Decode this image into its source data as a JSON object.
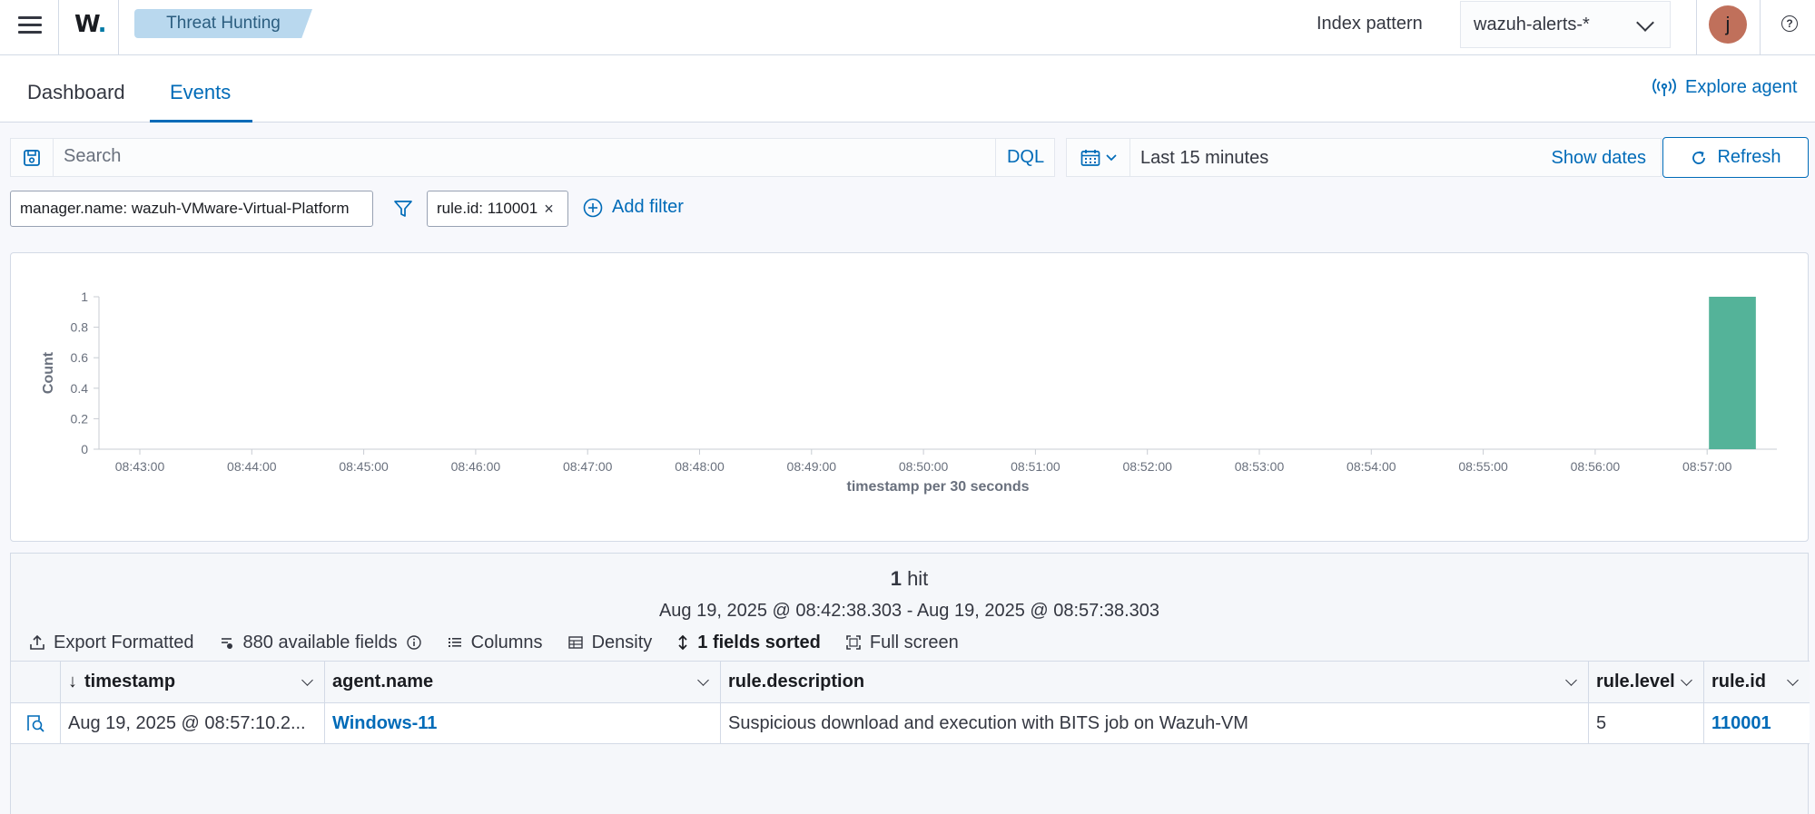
{
  "header": {
    "logo_text": "W",
    "breadcrumb": "Threat Hunting",
    "index_pattern_label": "Index pattern",
    "index_pattern_value": "wazuh-alerts-*",
    "avatar_initial": "j",
    "help_symbol": "?"
  },
  "tabs": [
    {
      "label": "Dashboard",
      "active": false
    },
    {
      "label": "Events",
      "active": true
    }
  ],
  "explore_agent_label": "Explore agent",
  "search": {
    "placeholder": "Search",
    "language": "DQL",
    "date_range": "Last 15 minutes",
    "show_dates_label": "Show dates",
    "refresh_label": "Refresh"
  },
  "filters": {
    "pills": [
      "manager.name: wazuh-VMware-Virtual-Platform",
      "rule.id: 110001"
    ],
    "add_filter_label": "Add filter"
  },
  "chart_data": {
    "type": "bar",
    "xlabel": "timestamp per 30 seconds",
    "ylabel": "Count",
    "ylim": [
      0,
      1
    ],
    "y_ticks": [
      "0",
      "0.2",
      "0.4",
      "0.6",
      "0.8",
      "1"
    ],
    "x_ticks": [
      "08:43:00",
      "08:44:00",
      "08:45:00",
      "08:46:00",
      "08:47:00",
      "08:48:00",
      "08:49:00",
      "08:50:00",
      "08:51:00",
      "08:52:00",
      "08:53:00",
      "08:54:00",
      "08:55:00",
      "08:56:00",
      "08:57:00"
    ],
    "bars": [
      {
        "x": "08:57:00",
        "value": 1
      }
    ],
    "bar_color": "#54b399",
    "grid": false
  },
  "results": {
    "hits_count": "1",
    "hits_label": "hit",
    "range": "Aug 19, 2025 @ 08:42:38.303 - Aug 19, 2025 @ 08:57:38.303",
    "toolbar": {
      "export": "Export Formatted",
      "fields": "880 available fields",
      "columns": "Columns",
      "density": "Density",
      "sorted": "1 fields sorted",
      "fullscreen": "Full screen"
    },
    "columns": [
      "timestamp",
      "agent.name",
      "rule.description",
      "rule.level",
      "rule.id"
    ],
    "rows": [
      {
        "timestamp": "Aug 19, 2025 @ 08:57:10.2...",
        "agent_name": "Windows-11",
        "rule_description": "Suspicious download and execution with BITS job on Wazuh-VM",
        "rule_level": "5",
        "rule_id": "110001"
      }
    ]
  },
  "colors": {
    "accent": "#006bb8",
    "breadcrumb_bg": "#b9d8ee",
    "avatar_bg": "#c0705b"
  }
}
